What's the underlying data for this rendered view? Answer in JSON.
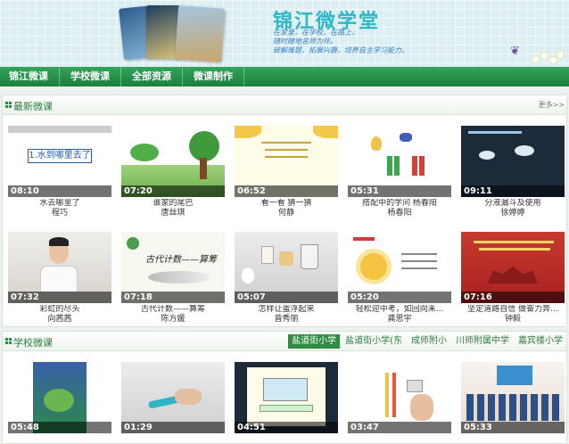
{
  "site": {
    "title": "锦江微学堂",
    "slogan_lines": [
      "在家里，在学校，在路上，",
      "随时随地名师为伴。",
      "破解难题，拓展兴趣，培养自主学习能力。"
    ]
  },
  "nav": [
    "锦江微课",
    "学校微课",
    "全部资源",
    "微课制作"
  ],
  "latest": {
    "title": "最新微课",
    "more": "更多>>",
    "cards": [
      {
        "duration": "08:10",
        "title": "水去哪里了",
        "author": "程巧",
        "slide_title": "1.水到哪里去了"
      },
      {
        "duration": "07:20",
        "title": "谁家的尾巴",
        "author": "唐丝琪"
      },
      {
        "duration": "06:52",
        "title": "看一看 猜一猜",
        "author": "何静"
      },
      {
        "duration": "05:31",
        "title": "搭配中的学问 杨春阳",
        "author": "杨春阳"
      },
      {
        "duration": "09:11",
        "title": "分液漏斗及使用",
        "author": "徐婷婷"
      },
      {
        "duration": "07:32",
        "title": "彩虹的尽头",
        "author": "向茜茜"
      },
      {
        "duration": "07:18",
        "title": "古代计数——算筹",
        "author": "陈方媛",
        "slide_title": "古代计数——算筹"
      },
      {
        "duration": "05:07",
        "title": "怎样让蛋浮起来",
        "author": "曾秀丽"
      },
      {
        "duration": "05:20",
        "title": "轻松迎中考，如回向未...",
        "author": "龚思宇"
      },
      {
        "duration": "07:16",
        "title": "坚定道路自信 做奋力奔...",
        "author": "钟毅"
      }
    ]
  },
  "school": {
    "title": "学校微课",
    "tabs": [
      "盐道街小学",
      "盐道街小学(东",
      "成师附小",
      "川师附属中学",
      "嘉宾楼小学"
    ],
    "cards": [
      {
        "duration": "05:48",
        "title": "",
        "author": ""
      },
      {
        "duration": "01:29",
        "title": "",
        "author": ""
      },
      {
        "duration": "04:51",
        "title": "",
        "author": ""
      },
      {
        "duration": "03:47",
        "title": "",
        "author": ""
      },
      {
        "duration": "05:33",
        "title": "",
        "author": ""
      }
    ]
  },
  "colors": {
    "nav_green": "#1b7f3c",
    "accent_teal": "#2fb6c6",
    "section_green": "#2c7a3c"
  }
}
